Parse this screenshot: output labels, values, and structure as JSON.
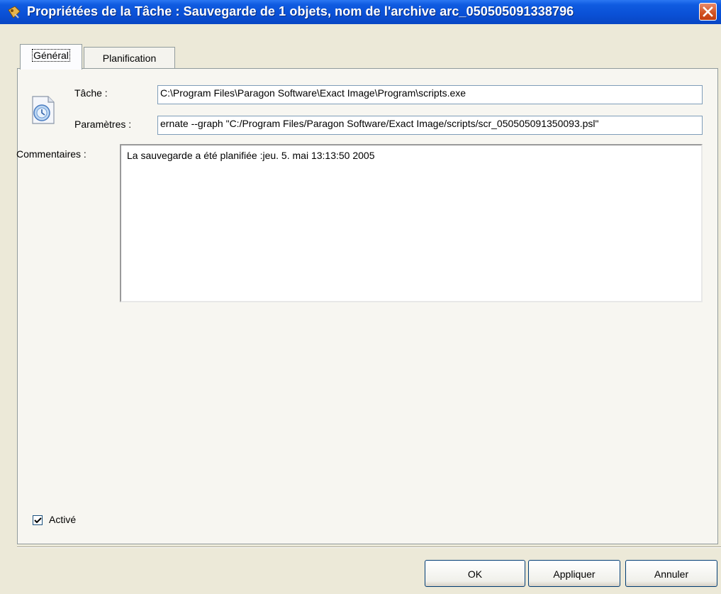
{
  "window": {
    "title": "Propriétées de la Tâche : Sauvegarde de 1 objets, nom de l'archive arc_050505091338796"
  },
  "tabs": [
    {
      "label": "Général",
      "active": true
    },
    {
      "label": "Planification",
      "active": false
    }
  ],
  "general": {
    "task_label": "Tâche :",
    "task_value": "C:\\Program Files\\Paragon Software\\Exact Image\\Program\\scripts.exe",
    "params_label": "Paramètres :",
    "params_value": "ernate --graph \"C:/Program Files/Paragon Software/Exact Image/scripts/scr_050505091350093.psl\"",
    "comments_label": "Commentaires :",
    "comments_value": "La sauvegarde a été planifiée :jeu. 5. mai 13:13:50 2005",
    "enabled_label": "Activé",
    "enabled_checked": true
  },
  "buttons": {
    "ok": "OK",
    "apply": "Appliquer",
    "cancel": "Annuler"
  },
  "colors": {
    "titlebar": "#0a50d6",
    "dialog_bg": "#ece9d8",
    "close": "#d35424"
  }
}
